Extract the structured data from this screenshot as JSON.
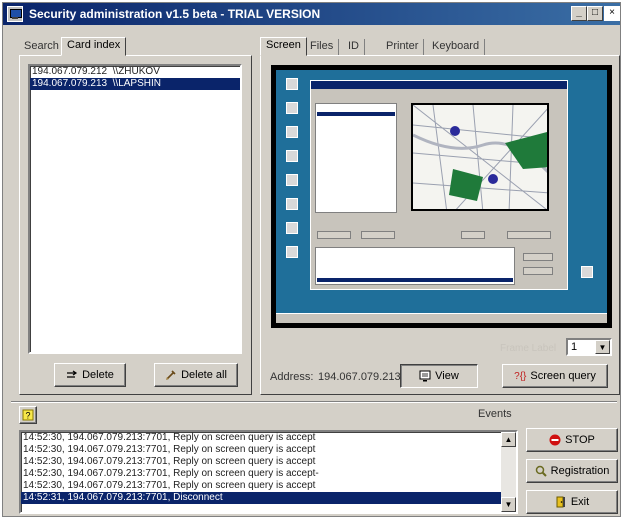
{
  "window": {
    "title": "Security administration v1.5 beta - TRIAL VERSION",
    "minimize_glyph": "_",
    "maximize_glyph": "□",
    "close_glyph": "×"
  },
  "left_tabs": [
    {
      "label": "Search",
      "active": false
    },
    {
      "label": "Card index",
      "active": true
    }
  ],
  "hosts": [
    {
      "ip": "194.067.079.212",
      "name": "\\\\ZHUKOV",
      "selected": false
    },
    {
      "ip": "194.067.079.213",
      "name": "\\\\LAPSHIN",
      "selected": true
    }
  ],
  "left_buttons": {
    "delete": "Delete",
    "delete_all": "Delete all"
  },
  "right_tabs": [
    {
      "label": "Screen",
      "active": true
    },
    {
      "label": "Files",
      "active": false
    },
    {
      "label": "ID",
      "active": false
    },
    {
      "label": "Printer",
      "active": false
    },
    {
      "label": "Keyboard",
      "active": false
    }
  ],
  "screen": {
    "frame_label": "Frame Label",
    "frame_value": "1",
    "address_label": "Address:",
    "address_value": "194.067.079.213",
    "view_button": "View",
    "query_button": "Screen query",
    "query_glyph": "?{}"
  },
  "events": {
    "label": "Events",
    "log": [
      {
        "text": "14:52:30, 194.067.079.213:7701, Reply on screen query is accept",
        "selected": false
      },
      {
        "text": "14:52:30, 194.067.079.213:7701, Reply on screen query is accept",
        "selected": false
      },
      {
        "text": "14:52:30, 194.067.079.213:7701, Reply on screen query is accept",
        "selected": false
      },
      {
        "text": "14:52:30, 194.067.079.213:7701, Reply on screen query is accept-",
        "selected": false
      },
      {
        "text": "14:52:30, 194.067.079.213:7701, Reply on screen query is accept",
        "selected": false
      },
      {
        "text": "14:52:31, 194.067.079.213:7701, Disconnect",
        "selected": true
      }
    ]
  },
  "right_buttons": {
    "stop": "STOP",
    "registration": "Registration",
    "exit": "Exit"
  },
  "colors": {
    "selection": "#0a246a",
    "face": "#d4d0c8",
    "stop_red": "#d01010",
    "help_yellow": "#f8e84a"
  },
  "icons": {
    "help": "help-icon",
    "delete": "delete-icon",
    "delete_all": "delete-all-icon",
    "view": "monitor-icon",
    "query": "query-icon",
    "stop": "stop-icon",
    "registration": "registration-icon",
    "exit": "exit-icon"
  }
}
